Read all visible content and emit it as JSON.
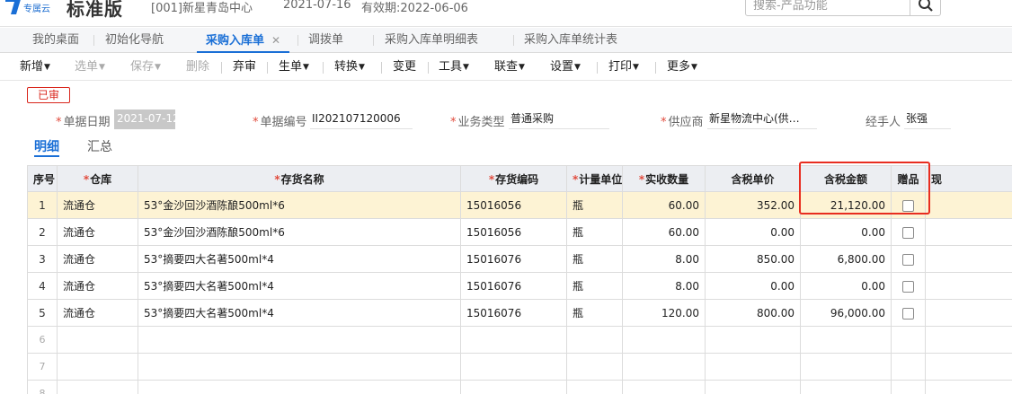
{
  "header": {
    "logo_sub": "专属云",
    "logo_main": "标准版",
    "account": "[001]新星青岛中心",
    "date": "2021-07-16",
    "valid": "有效期:2022-06-06",
    "search_placeholder": "搜索-产品功能",
    "brand_color": "#1a6fd6"
  },
  "tabs": [
    {
      "label": "我的桌面"
    },
    {
      "label": "初始化导航"
    },
    {
      "label": "采购入库单",
      "close": "✕"
    },
    {
      "label": "调拨单"
    },
    {
      "label": "采购入库单明细表"
    },
    {
      "label": "采购入库单统计表"
    }
  ],
  "toolbar": {
    "new": "新增",
    "select": "选单",
    "save": "保存",
    "delete": "删除",
    "abandon": "弃审",
    "generate": "生单",
    "convert": "转换",
    "change": "变更",
    "tools": "工具",
    "linked_query": "联查",
    "settings": "设置",
    "print": "打印",
    "more": "更多"
  },
  "form": {
    "status": "已审",
    "date_label": "单据日期",
    "date_value": "2021-07-12",
    "code_label": "单据编号",
    "code_value": "II202107120006",
    "type_label": "业务类型",
    "type_value": "普通采购",
    "supplier_label": "供应商",
    "supplier_value": "新星物流中心(供…",
    "handler_label": "经手人",
    "handler_value": "张强"
  },
  "subtabs": {
    "detail": "明细",
    "summary": "汇总"
  },
  "grid": {
    "headers": {
      "seq": "序号",
      "warehouse": "仓库",
      "name": "存货名称",
      "code": "存货编码",
      "unit": "计量单位",
      "qty": "实收数量",
      "price": "含税单价",
      "amount": "含税金额",
      "gift": "赠品",
      "extra": "现"
    },
    "rows": [
      {
        "seq": "1",
        "warehouse": "流通仓",
        "name": "53°金沙回沙酒陈酿500ml*6",
        "code": "15016056",
        "unit": "瓶",
        "qty": "60.00",
        "price": "352.00",
        "amount": "21,120.00"
      },
      {
        "seq": "2",
        "warehouse": "流通仓",
        "name": "53°金沙回沙酒陈酿500ml*6",
        "code": "15016056",
        "unit": "瓶",
        "qty": "60.00",
        "price": "0.00",
        "amount": "0.00"
      },
      {
        "seq": "3",
        "warehouse": "流通仓",
        "name": "53°摘要四大名著500ml*4",
        "code": "15016076",
        "unit": "瓶",
        "qty": "8.00",
        "price": "850.00",
        "amount": "6,800.00"
      },
      {
        "seq": "4",
        "warehouse": "流通仓",
        "name": "53°摘要四大名著500ml*4",
        "code": "15016076",
        "unit": "瓶",
        "qty": "8.00",
        "price": "0.00",
        "amount": "0.00"
      },
      {
        "seq": "5",
        "warehouse": "流通仓",
        "name": "53°摘要四大名著500ml*4",
        "code": "15016076",
        "unit": "瓶",
        "qty": "120.00",
        "price": "800.00",
        "amount": "96,000.00"
      }
    ],
    "blank_rows": [
      "6",
      "7",
      "8"
    ]
  }
}
